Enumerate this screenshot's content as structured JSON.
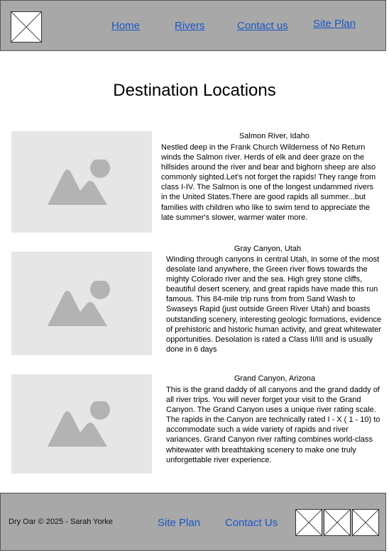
{
  "header": {
    "nav": [
      {
        "label": "Home"
      },
      {
        "label": "Rivers"
      },
      {
        "label": "Contact us"
      },
      {
        "label": "Site Plan"
      }
    ]
  },
  "main": {
    "title": "Destination Locations",
    "destinations": [
      {
        "name": "Salmon River, Idaho",
        "description": "Nestled deep in the Frank Church Wilderness of No Return winds the Salmon river. Herds of elk and deer graze on the hillsides around the river and bear and bighorn sheep are also commonly sighted.Let's not forget the rapids! They range from class I-IV. The Salmon is one of the longest undammed rivers in the United States.There are good rapids all summer...but families with children who like to swim tend to appreciate the late summer's slower, warmer water more."
      },
      {
        "name": "Gray Canyon, Utah",
        "description": "Winding through canyons in central Utah, in some of the most desolate land anywhere, the Green river flows towards the mighty Colorado river and the sea. High grey stone cliffs, beautiful desert scenery, and great rapids have made this run famous. This 84-mile trip runs from from Sand Wash to Swaseys Rapid (just outside Green River Utah) and boasts outstanding scenery, interesting geologic formations, evidence of prehistoric and historic human activity, and great whitewater opportunities. Desolation is rated a Class II/III and is usually done in 6 days"
      },
      {
        "name": "Grand Canyon, Arizona",
        "description": "This is the grand daddy of all canyons and the grand daddy of all river trips. You will never forget your visit to the Grand Canyon. The Grand Canyon uses a unique river rating scale. The rapids in the Canyon are technically rated I - X ( 1 - 10) to accommodate such a wide variety of rapids and river variances. Grand Canyon river rafting combines world-class whitewater with breathtaking scenery to make one truly unforgettable river experience."
      }
    ]
  },
  "footer": {
    "copyright": "Dry Oar © 2025 - Sarah Yorke",
    "links": [
      {
        "label": "Site Plan"
      },
      {
        "label": "Contact Us"
      }
    ]
  }
}
